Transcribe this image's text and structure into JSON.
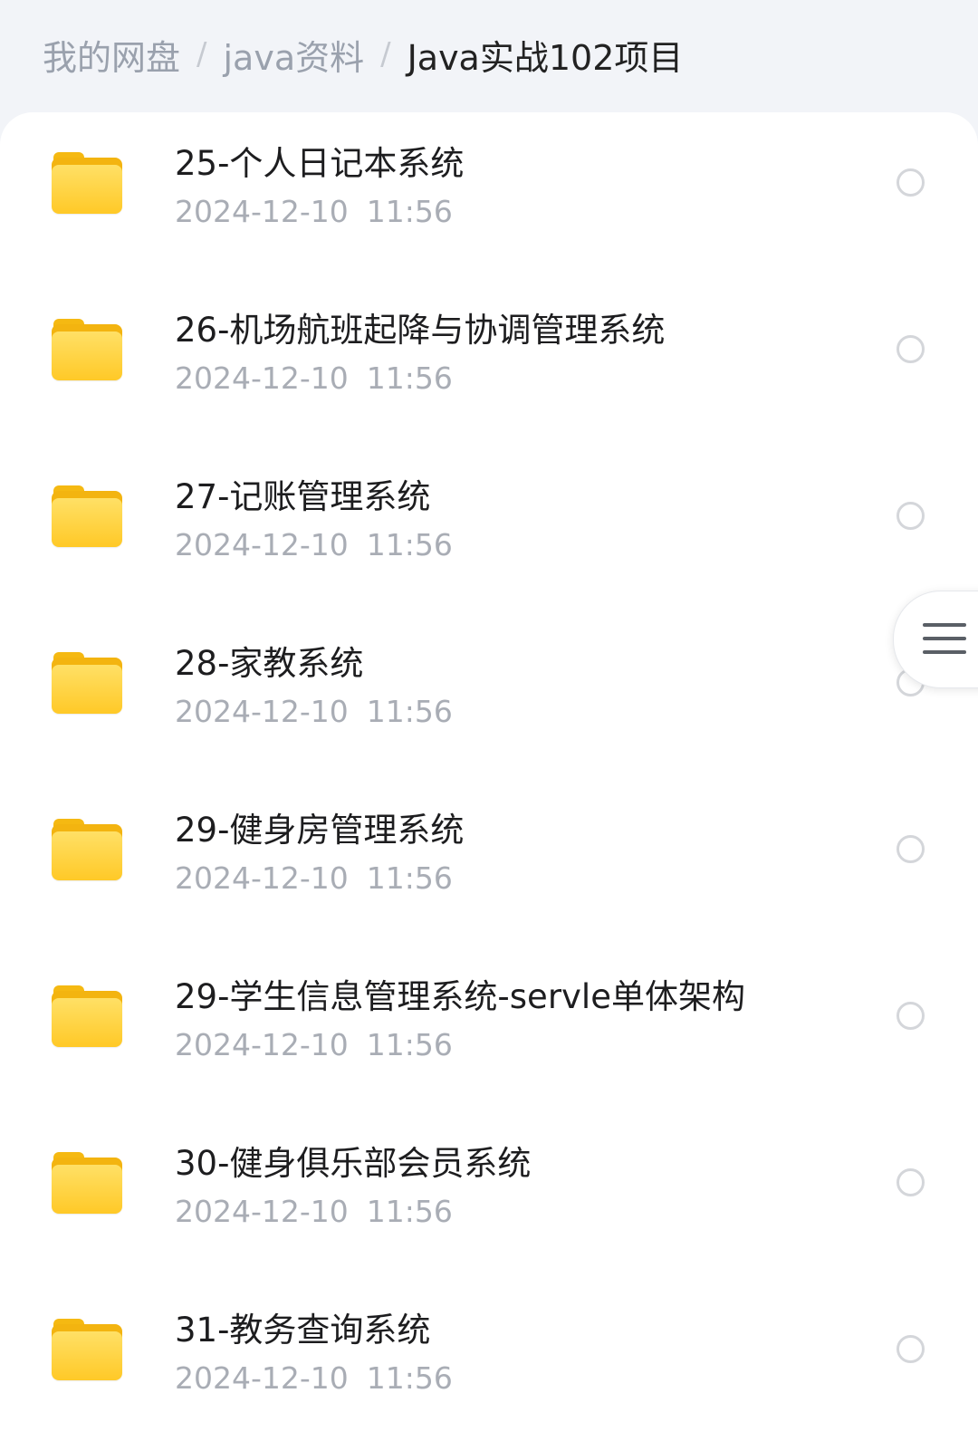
{
  "breadcrumb": {
    "root": "我的网盘",
    "parent": "java资料",
    "current": "Java实战102项目",
    "separator": "/"
  },
  "files": [
    {
      "name": "25-个人日记本系统",
      "date": "2024-12-10",
      "time": "11:56"
    },
    {
      "name": "26-机场航班起降与协调管理系统",
      "date": "2024-12-10",
      "time": "11:56"
    },
    {
      "name": "27-记账管理系统",
      "date": "2024-12-10",
      "time": "11:56"
    },
    {
      "name": "28-家教系统",
      "date": "2024-12-10",
      "time": "11:56"
    },
    {
      "name": "29-健身房管理系统",
      "date": "2024-12-10",
      "time": "11:56"
    },
    {
      "name": "29-学生信息管理系统-servle单体架构",
      "date": "2024-12-10",
      "time": "11:56"
    },
    {
      "name": "30-健身俱乐部会员系统",
      "date": "2024-12-10",
      "time": "11:56"
    },
    {
      "name": "31-教务查询系统",
      "date": "2024-12-10",
      "time": "11:56"
    }
  ],
  "icons": {
    "folder": "folder-icon",
    "select": "radio-circle-icon",
    "menu": "hamburger-menu-icon"
  },
  "colors": {
    "folder": "#ffc927",
    "title": "#1d1d1f",
    "meta": "#a9adb5",
    "breadcrumb_inactive": "#9aa1ad"
  }
}
